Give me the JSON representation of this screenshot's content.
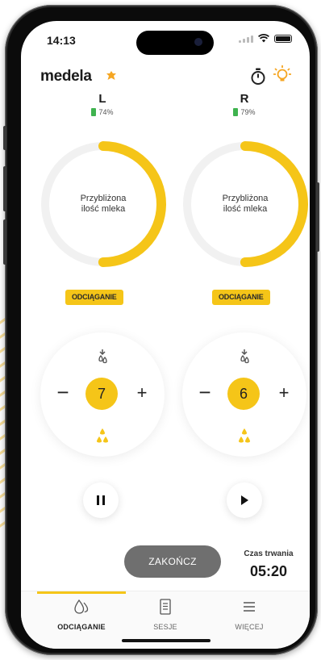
{
  "status_bar": {
    "time": "14:13"
  },
  "app": {
    "logo_text": "medela",
    "brand_color": "#f5a623",
    "accent_color": "#f5c518"
  },
  "left": {
    "side": "L",
    "battery": "74%",
    "ring_text_line1": "Przybliżona",
    "ring_text_line2": "ilość mleka",
    "ring_fill_fraction": 0.5,
    "mode_label": "ODCIĄGANIE",
    "level": "7",
    "playback_state": "pause"
  },
  "right": {
    "side": "R",
    "battery": "79%",
    "ring_text_line1": "Przybliżona",
    "ring_text_line2": "ilość mleka",
    "ring_fill_fraction": 0.5,
    "mode_label": "ODCIĄGANIE",
    "level": "6",
    "playback_state": "play"
  },
  "controls": {
    "minus": "−",
    "plus": "+"
  },
  "session": {
    "end_label": "ZAKOŃCZ",
    "duration_label": "Czas trwania",
    "duration_value": "05:20"
  },
  "tabs": [
    {
      "label": "ODCIĄGANIE",
      "icon": "drop-icon",
      "active": true
    },
    {
      "label": "SESJE",
      "icon": "list-icon",
      "active": false
    },
    {
      "label": "WIĘCEJ",
      "icon": "menu-icon",
      "active": false
    }
  ]
}
